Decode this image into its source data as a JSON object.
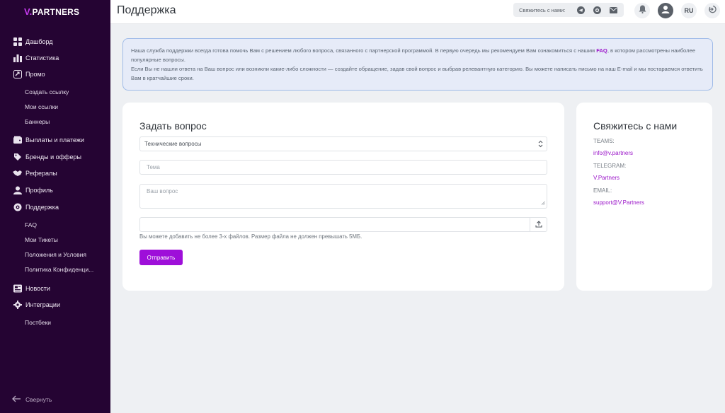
{
  "brand": {
    "v": "V.",
    "name": "PARTNERS",
    "accent": "#9e0fd9"
  },
  "sidebar": {
    "items": [
      {
        "label": "Дашборд",
        "icon": "dashboard-icon"
      },
      {
        "label": "Статистика",
        "icon": "bar-chart-icon"
      },
      {
        "label": "Промо",
        "icon": "link-icon"
      },
      {
        "label": "Создать ссылку"
      },
      {
        "label": "Мои ссылки"
      },
      {
        "label": "Баннеры"
      },
      {
        "label": "Выплаты и платежи",
        "icon": "wallet-icon"
      },
      {
        "label": "Бренды и офферы",
        "icon": "tag-icon"
      },
      {
        "label": "Рефералы",
        "icon": "handshake-icon"
      },
      {
        "label": "Профиль",
        "icon": "user-icon"
      },
      {
        "label": "Поддержка",
        "icon": "support-icon"
      },
      {
        "label": "FAQ"
      },
      {
        "label": "Мои Тикеты"
      },
      {
        "label": "Положения и Условия"
      },
      {
        "label": "Политика Конфиденци..."
      },
      {
        "label": "Новости",
        "icon": "news-icon"
      },
      {
        "label": "Интеграции",
        "icon": "gear-icon"
      },
      {
        "label": "Постбеки"
      }
    ],
    "collapse_label": "Свернуть"
  },
  "header": {
    "title": "Поддержка",
    "contact_label": "Свяжитесь с нами:",
    "language": "RU"
  },
  "banner": {
    "text_1": "Наша служба поддержки всегда готова помочь Вам с решением любого вопроса, связанного с партнерской программой. В первую очередь мы рекомендуем Вам ознакомиться с нашим ",
    "faq_link": "FAQ",
    "text_2": ", в котором рассмотрены наиболее популярные вопросы.",
    "text_3": "Если Вы не нашли ответа на Ваш вопрос или возникли какие-либо сложности — создайте обращение, задав свой вопрос и выбрав релевантную категорию. Вы можете написать письмо на наш E-mail и мы постараемся ответить Вам в кратчайшие сроки."
  },
  "form": {
    "title": "Задать вопрос",
    "category_value": "Технические вопросы",
    "subject_placeholder": "Тема",
    "question_placeholder": "Ваш вопрос",
    "file_hint": "Вы можете добавить не более 3-х файлов. Размер файла не должен превышать 5МБ.",
    "submit_label": "Отправить"
  },
  "contacts": {
    "title": "Свяжитесь с нами",
    "teams_label": "TEAMS:",
    "teams_value": "info@v.partners",
    "telegram_label": "TELEGRAM:",
    "telegram_value": "V.Partners",
    "email_label": "EMAIL:",
    "email_value": "support@V.Partners"
  }
}
